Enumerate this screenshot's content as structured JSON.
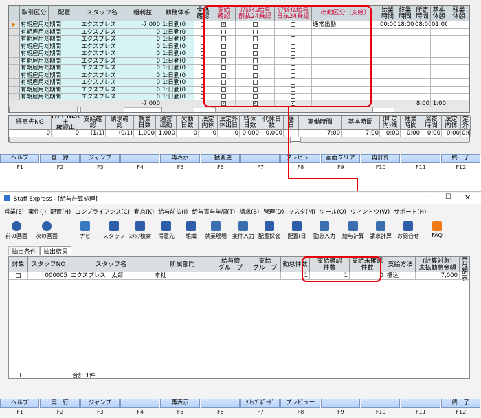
{
  "top": {
    "headers": [
      {
        "label": "取引区分",
        "pink": false
      },
      {
        "label": "配置",
        "pink": false
      },
      {
        "label": "スタッフ名",
        "pink": false
      },
      {
        "label": "粗利益",
        "pink": false
      },
      {
        "label": "勤務体系",
        "pink": false
      },
      {
        "label": "全休\n確認",
        "pink": false
      },
      {
        "label": "支給\n確認",
        "pink": true
      },
      {
        "label": "ﾘｱﾙﾀｲﾑ給与\n前払24乗認",
        "pink": true
      },
      {
        "label": "ﾘｱﾙﾀｲﾑ給与\n日払24乗認",
        "pink": true
      },
      {
        "label": "出勤区分（支給）",
        "pink": true
      },
      {
        "label": "始業\n時間",
        "pink": false
      },
      {
        "label": "終業\n時間",
        "pink": false
      },
      {
        "label": "所定\n時間",
        "pink": false
      },
      {
        "label": "基本\n休憩",
        "pink": false
      },
      {
        "label": "残業\n休憩",
        "pink": false
      }
    ],
    "rows": [
      {
        "torihiki": "有期雇用ｽﾀ",
        "haichi": "期間",
        "name": "エクスプレス",
        "arari": "-7,000",
        "kinmu": "1:日勤(0",
        "shiky": "✓",
        "shukkin": "通常出勤",
        "shigyo": "00:00",
        "shugyo": "18:00",
        "shotei": "08:00",
        "kihon": "01:00",
        "zangyo": ""
      },
      {
        "torihiki": "有期雇用ｽﾀ",
        "haichi": "期間",
        "name": "エクスプレス",
        "arari": "0",
        "kinmu": "1:日勤(0",
        "shiky": "",
        "shukkin": "",
        "shigyo": "",
        "shugyo": "",
        "shotei": "",
        "kihon": "",
        "zangyo": ""
      },
      {
        "torihiki": "有期雇用ｽﾀ",
        "haichi": "期間",
        "name": "エクスプレス",
        "arari": "0",
        "kinmu": "1:日勤(0",
        "shiky": "",
        "shukkin": "",
        "shigyo": "",
        "shugyo": "",
        "shotei": "",
        "kihon": "",
        "zangyo": ""
      },
      {
        "torihiki": "有期雇用ｽﾀ",
        "haichi": "期間",
        "name": "エクスプレス",
        "arari": "0",
        "kinmu": "1:日勤(0",
        "shiky": "",
        "shukkin": "",
        "shigyo": "",
        "shugyo": "",
        "shotei": "",
        "kihon": "",
        "zangyo": ""
      },
      {
        "torihiki": "有期雇用ｽﾀ",
        "haichi": "期間",
        "name": "エクスプレス",
        "arari": "0",
        "kinmu": "1:日勤(0",
        "shiky": "",
        "shukkin": "",
        "shigyo": "",
        "shugyo": "",
        "shotei": "",
        "kihon": "",
        "zangyo": ""
      },
      {
        "torihiki": "有期雇用ｽﾀ",
        "haichi": "期間",
        "name": "エクスプレス",
        "arari": "0",
        "kinmu": "1:日勤(0",
        "shiky": "",
        "shukkin": "",
        "shigyo": "",
        "shugyo": "",
        "shotei": "",
        "kihon": "",
        "zangyo": ""
      },
      {
        "torihiki": "有期雇用ｽﾀ",
        "haichi": "期間",
        "name": "エクスプレス",
        "arari": "0",
        "kinmu": "1:日勤(0",
        "shiky": "",
        "shukkin": "",
        "shigyo": "",
        "shugyo": "",
        "shotei": "",
        "kihon": "",
        "zangyo": ""
      },
      {
        "torihiki": "有期雇用ｽﾀ",
        "haichi": "期間",
        "name": "エクスプレス",
        "arari": "0",
        "kinmu": "1:日勤(0",
        "shiky": "",
        "shukkin": "",
        "shigyo": "",
        "shugyo": "",
        "shotei": "",
        "kihon": "",
        "zangyo": ""
      },
      {
        "torihiki": "有期雇用ｽﾀ",
        "haichi": "期間",
        "name": "エクスプレス",
        "arari": "0",
        "kinmu": "1:日勤(0",
        "shiky": "",
        "shukkin": "",
        "shigyo": "",
        "shugyo": "",
        "shotei": "",
        "kihon": "",
        "zangyo": ""
      },
      {
        "torihiki": "有期雇用ｽﾀ",
        "haichi": "期間",
        "name": "エクスプレス",
        "arari": "0",
        "kinmu": "1:日勤(0",
        "shiky": "",
        "shukkin": "",
        "shigyo": "",
        "shugyo": "",
        "shotei": "",
        "kihon": "",
        "zangyo": ""
      },
      {
        "torihiki": "有期雇用ｽﾀ",
        "haichi": "期間",
        "name": "エクスプレス",
        "arari": "0",
        "kinmu": "1:日勤(0",
        "shiky": "",
        "shukkin": "",
        "shigyo": "",
        "shugyo": "",
        "shotei": "",
        "kihon": "",
        "zangyo": ""
      }
    ],
    "total_row": {
      "arari": "-7,000",
      "shiky": "✓",
      "rt1": "✓",
      "rt2": "✓",
      "shotei": "8:00",
      "kihon": "1:00"
    },
    "summary_headers": [
      "得意先NG",
      "PARTNER＋\n確認中",
      "支給確\n認",
      "請求確\n認",
      "就業\n日数",
      "通常\n出勤",
      "欠勤\n日数",
      "法定\n内休",
      "法定外\n休出日",
      "特休\n日数",
      "代休日\n数",
      "振\n日",
      "実働時間",
      "基本時間",
      "(所定\n内)残",
      "残業\n時間",
      "深夜\n時間",
      "法定\n内休",
      "法定\n外休"
    ],
    "summary_values": [
      "0",
      "0",
      "(1/1)",
      "(0/1)",
      "1.000",
      "1.000",
      "0",
      "0",
      "0",
      "0.000",
      "0.000",
      "",
      "7:00",
      "7:00",
      "0:00",
      "0:00",
      "0:00",
      "0:00",
      "0:00"
    ]
  },
  "top_fkeys": [
    {
      "label": "ヘルプ",
      "key": "F1"
    },
    {
      "label": "登　録",
      "key": "F2"
    },
    {
      "label": "ジャンプ",
      "key": "F3"
    },
    {
      "label": "",
      "key": "F4"
    },
    {
      "label": "再表示",
      "key": "F5"
    },
    {
      "label": "一括変更",
      "key": "F6"
    },
    {
      "label": "",
      "key": "F7"
    },
    {
      "label": "プレビュー",
      "key": "F8"
    },
    {
      "label": "画面クリア",
      "key": "F9"
    },
    {
      "label": "再計算",
      "key": "F10"
    },
    {
      "label": "",
      "key": "F11"
    },
    {
      "label": "終　了",
      "key": "F12"
    }
  ],
  "window": {
    "title": "Staff Express - [給与計算処理]",
    "menu": [
      "営業(E)",
      "案件(J)",
      "配置(H)",
      "コンプライアンス(C)",
      "勤怠(K)",
      "給与前払(I)",
      "給与賞与年調(T)",
      "請求(S)",
      "管理(D)",
      "マスタ(M)",
      "ツール(O)",
      "ウィンドウ(W)",
      "サポート(H)"
    ],
    "toolbar": [
      "前の画面",
      "次の画面",
      "ナビ",
      "スタッフ",
      "ｽﾀｯﾌ検索",
      "得意先",
      "組織",
      "就業現場",
      "案件入力",
      "配置採会",
      "配置(日",
      "勤怠入力",
      "給与計算",
      "請求計算",
      "お問合せ",
      "FAQ"
    ],
    "tabs": [
      "抽出条件",
      "抽出結果"
    ],
    "headers": [
      "対象",
      "スタッフNO",
      "スタッフ名",
      "所属部門",
      "給与締\nグループ",
      "支給\nグループ",
      "勤怠件数",
      "支給確認\n件数",
      "支給未確認\n件数",
      "支給方法",
      "(計算対象)\n未払勤怠金額",
      "(計算\n月額表"
    ],
    "row": {
      "no": "000005",
      "name": "エクスプレス　太郎",
      "dept": "本社",
      "kintai": "1",
      "kakunin": "1",
      "mikakunin": "0",
      "houhou": "振込",
      "amount": "7,000"
    },
    "total": "合計 1件"
  },
  "bottom_fkeys": [
    {
      "label": "ヘルプ",
      "key": "F1"
    },
    {
      "label": "実　行",
      "key": "F2"
    },
    {
      "label": "ジャンプ",
      "key": "F3"
    },
    {
      "label": "",
      "key": "F4"
    },
    {
      "label": "再表示",
      "key": "F5"
    },
    {
      "label": "",
      "key": "F6"
    },
    {
      "label": "ｸﾘｯﾌﾟﾎﾞｰﾄﾞ",
      "key": "F7"
    },
    {
      "label": "プレビュー",
      "key": "F8"
    },
    {
      "label": "",
      "key": "F9"
    },
    {
      "label": "",
      "key": "F10"
    },
    {
      "label": "",
      "key": "F11"
    },
    {
      "label": "終　了",
      "key": "F12"
    }
  ],
  "colors": {
    "highlight": "#e8000b",
    "header_pink": "#cc0033",
    "cell_cyan": "#d7f4f4",
    "fkey_blue": "#b8d3f5"
  }
}
